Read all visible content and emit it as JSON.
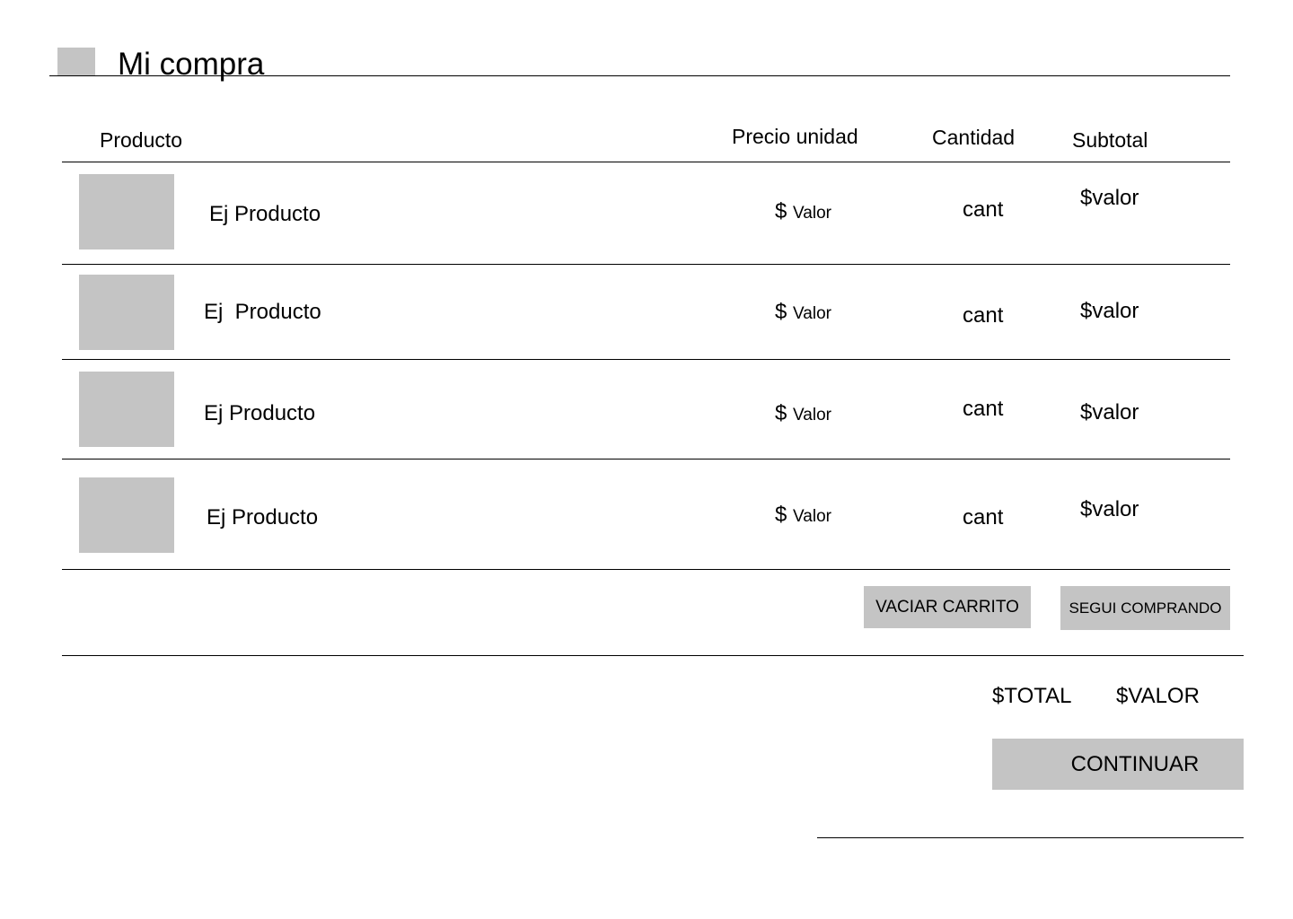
{
  "header": {
    "title": "Mi compra",
    "icon": "image-placeholder-icon"
  },
  "table": {
    "columns": {
      "producto": "Producto",
      "precio": "Precio unidad",
      "cantidad": "Cantidad",
      "subtotal": "Subtotal"
    },
    "rows": [
      {
        "name": "Ej Producto",
        "price_symbol": "$",
        "price_value": "Valor",
        "qty": "cant",
        "subtotal": "$valor"
      },
      {
        "name": "Ej  Producto",
        "price_symbol": "$",
        "price_value": "Valor",
        "qty": "cant",
        "subtotal": "$valor"
      },
      {
        "name": "Ej Producto",
        "price_symbol": "$",
        "price_value": "Valor",
        "qty": "cant",
        "subtotal": "$valor"
      },
      {
        "name": "Ej Producto",
        "price_symbol": "$",
        "price_value": "Valor",
        "qty": "cant",
        "subtotal": "$valor"
      }
    ]
  },
  "actions": {
    "empty_cart_label": "VACIAR CARRITO",
    "keep_shopping_label": "SEGUI COMPRANDO"
  },
  "summary": {
    "total_label": "$TOTAL",
    "total_value": "$VALOR",
    "continue_label": "CONTINUAR"
  },
  "colors": {
    "placeholder": "#c4c4c4",
    "line": "#000000",
    "background": "#ffffff"
  }
}
